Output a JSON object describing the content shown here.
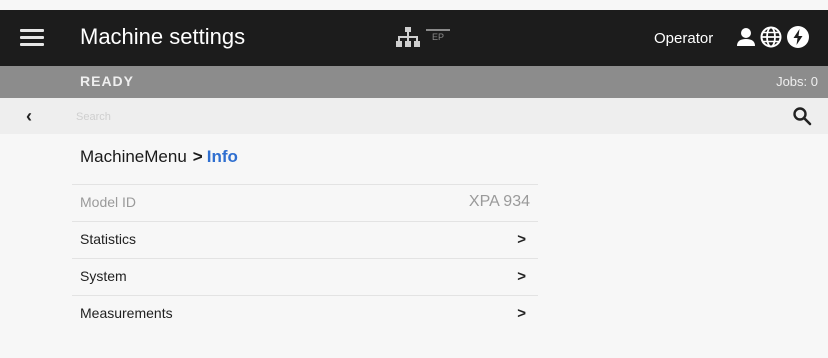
{
  "header": {
    "menu_icon": "hamburger-menu-icon",
    "title": "Machine settings",
    "network_icon": "network-icon",
    "ep_label": "EP",
    "user_label": "Operator",
    "user_icon": "user-icon",
    "globe_icon": "globe-icon",
    "power_icon": "power-icon"
  },
  "status": {
    "state": "READY",
    "jobs": "Jobs: 0"
  },
  "search": {
    "placeholder": "Search",
    "back_icon": "chevron-left-icon",
    "search_icon": "search-icon"
  },
  "breadcrumb": {
    "root": "MachineMenu",
    "separator": ">",
    "current": "Info"
  },
  "list": {
    "items": [
      {
        "label": "Model ID",
        "value": "XPA 934"
      },
      {
        "label": "Statistics",
        "chevron": ">"
      },
      {
        "label": "System",
        "chevron": ">"
      },
      {
        "label": "Measurements",
        "chevron": ">"
      }
    ]
  },
  "colors": {
    "header_bg": "#1c1c1c",
    "status_bg": "#8c8c8c",
    "accent": "#2f6fd0",
    "page_bg": "#f7f7f7"
  }
}
